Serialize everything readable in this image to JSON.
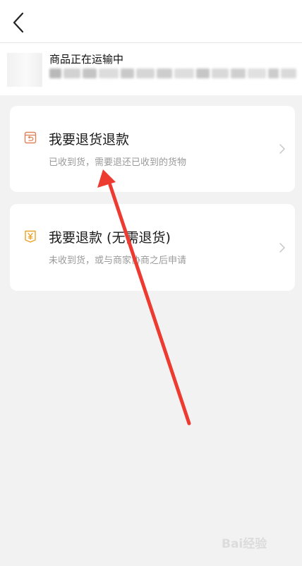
{
  "header": {
    "back_icon": "chevron-left-icon"
  },
  "product": {
    "status": "商品正在运输中"
  },
  "options": [
    {
      "icon": "return-box-icon",
      "title": "我要退货退款",
      "subtitle": "已收到货，需要退还已收到的货物"
    },
    {
      "icon": "yen-tag-icon",
      "title": "我要退款 (无需退货)",
      "subtitle": "未收到货，或与商家协商之后申请"
    }
  ],
  "watermark": "Bai经验",
  "colors": {
    "background": "#f2f2f2",
    "card": "#ffffff",
    "icon_return": "#e0825a",
    "icon_yen": "#e8a227",
    "annotation_arrow": "#ee3b32"
  }
}
